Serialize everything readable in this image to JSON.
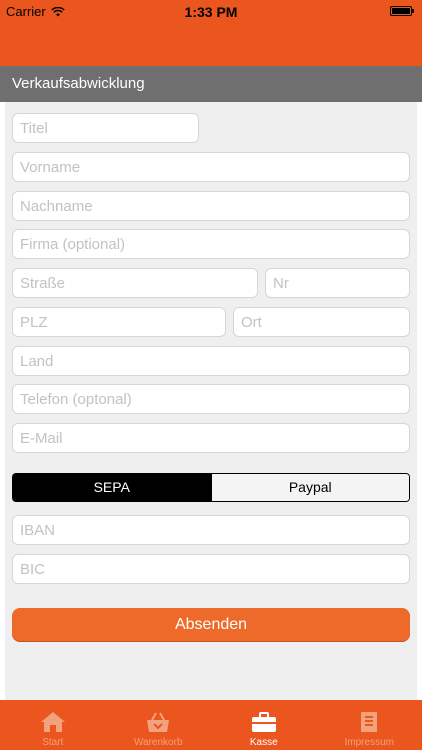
{
  "status_bar": {
    "carrier": "Carrier",
    "time": "1:33 PM"
  },
  "colors": {
    "brand_orange": "#ea561d",
    "button_orange": "#ee6a2a",
    "section_gray": "#6f6f6f"
  },
  "section": {
    "title": "Verkaufsabwicklung"
  },
  "form": {
    "titel": {
      "placeholder": "Titel",
      "value": ""
    },
    "vorname": {
      "placeholder": "Vorname",
      "value": ""
    },
    "nachname": {
      "placeholder": "Nachname",
      "value": ""
    },
    "firma": {
      "placeholder": "Firma (optional)",
      "value": ""
    },
    "strasse": {
      "placeholder": "Straße",
      "value": ""
    },
    "nr": {
      "placeholder": "Nr",
      "value": ""
    },
    "plz": {
      "placeholder": "PLZ",
      "value": ""
    },
    "ort": {
      "placeholder": "Ort",
      "value": ""
    },
    "land": {
      "placeholder": "Land",
      "value": ""
    },
    "telefon": {
      "placeholder": "Telefon (optonal)",
      "value": ""
    },
    "email": {
      "placeholder": "E-Mail",
      "value": ""
    }
  },
  "payment": {
    "options": [
      "SEPA",
      "Paypal"
    ],
    "selected": "SEPA",
    "iban": {
      "placeholder": "IBAN",
      "value": ""
    },
    "bic": {
      "placeholder": "BIC",
      "value": ""
    }
  },
  "submit_label": "Absenden",
  "tabs": [
    {
      "label": "Start",
      "icon": "home-icon",
      "active": false
    },
    {
      "label": "Warenkorb",
      "icon": "basket-icon",
      "active": false
    },
    {
      "label": "Kasse",
      "icon": "briefcase-icon",
      "active": true
    },
    {
      "label": "Impressum",
      "icon": "document-icon",
      "active": false
    }
  ]
}
